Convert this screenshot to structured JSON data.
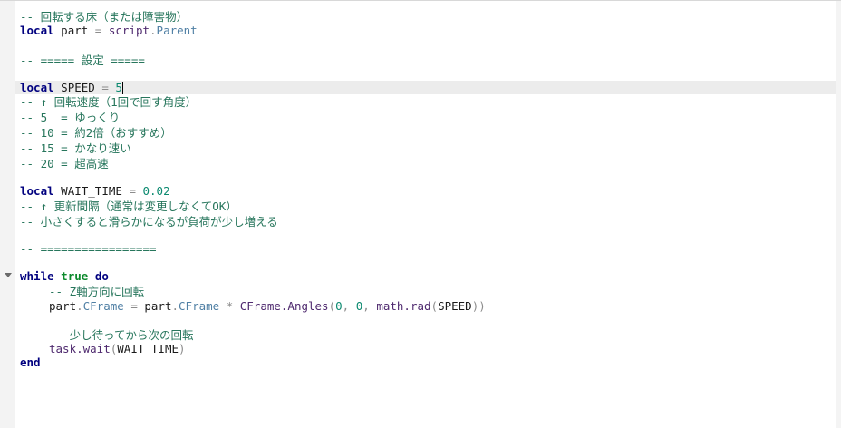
{
  "code": {
    "lines": [
      {
        "parts": [
          {
            "t": "-- 回転する床（または障害物）",
            "c": "cm"
          }
        ]
      },
      {
        "parts": [
          {
            "t": "local",
            "c": "kw"
          },
          {
            "t": " part ",
            "c": "id"
          },
          {
            "t": "=",
            "c": "op"
          },
          {
            "t": " ",
            "c": "id"
          },
          {
            "t": "script",
            "c": "fn"
          },
          {
            "t": ".",
            "c": "op"
          },
          {
            "t": "Parent",
            "c": "pr"
          }
        ]
      },
      {
        "parts": []
      },
      {
        "parts": [
          {
            "t": "-- ===== 設定 =====",
            "c": "cm"
          }
        ]
      },
      {
        "parts": []
      },
      {
        "parts": [
          {
            "t": "local",
            "c": "kw"
          },
          {
            "t": " SPEED ",
            "c": "id"
          },
          {
            "t": "=",
            "c": "op"
          },
          {
            "t": " ",
            "c": "id"
          },
          {
            "t": "5",
            "c": "nm"
          }
        ],
        "caret": true
      },
      {
        "parts": [
          {
            "t": "-- ↑ 回転速度（1回で回す角度）",
            "c": "cm"
          }
        ]
      },
      {
        "parts": [
          {
            "t": "-- 5  = ゆっくり",
            "c": "cm"
          }
        ]
      },
      {
        "parts": [
          {
            "t": "-- 10 = 約2倍（おすすめ）",
            "c": "cm"
          }
        ]
      },
      {
        "parts": [
          {
            "t": "-- 15 = かなり速い",
            "c": "cm"
          }
        ]
      },
      {
        "parts": [
          {
            "t": "-- 20 = 超高速",
            "c": "cm"
          }
        ]
      },
      {
        "parts": []
      },
      {
        "parts": [
          {
            "t": "local",
            "c": "kw"
          },
          {
            "t": " WAIT_TIME ",
            "c": "id"
          },
          {
            "t": "=",
            "c": "op"
          },
          {
            "t": " ",
            "c": "id"
          },
          {
            "t": "0.02",
            "c": "nm"
          }
        ]
      },
      {
        "parts": [
          {
            "t": "-- ↑ 更新間隔（通常は変更しなくてOK）",
            "c": "cm"
          }
        ]
      },
      {
        "parts": [
          {
            "t": "-- 小さくすると滑らかになるが負荷が少し増える",
            "c": "cm"
          }
        ]
      },
      {
        "parts": []
      },
      {
        "parts": [
          {
            "t": "-- =================",
            "c": "cm"
          }
        ]
      },
      {
        "parts": []
      },
      {
        "parts": [
          {
            "t": "while",
            "c": "kw"
          },
          {
            "t": " ",
            "c": "id"
          },
          {
            "t": "true",
            "c": "bl"
          },
          {
            "t": " ",
            "c": "id"
          },
          {
            "t": "do",
            "c": "kw"
          }
        ],
        "fold": true
      },
      {
        "indent": 1,
        "parts": [
          {
            "t": "-- Z軸方向に回転",
            "c": "cm"
          }
        ]
      },
      {
        "indent": 1,
        "parts": [
          {
            "t": "part",
            "c": "id"
          },
          {
            "t": ".",
            "c": "op"
          },
          {
            "t": "CFrame",
            "c": "pr"
          },
          {
            "t": " = ",
            "c": "op"
          },
          {
            "t": "part",
            "c": "id"
          },
          {
            "t": ".",
            "c": "op"
          },
          {
            "t": "CFrame",
            "c": "pr"
          },
          {
            "t": " * ",
            "c": "op"
          },
          {
            "t": "CFrame.Angles",
            "c": "fn"
          },
          {
            "t": "(",
            "c": "op"
          },
          {
            "t": "0",
            "c": "nm"
          },
          {
            "t": ", ",
            "c": "op"
          },
          {
            "t": "0",
            "c": "nm"
          },
          {
            "t": ", ",
            "c": "op"
          },
          {
            "t": "math.rad",
            "c": "fn"
          },
          {
            "t": "(",
            "c": "op"
          },
          {
            "t": "SPEED",
            "c": "id"
          },
          {
            "t": "))",
            "c": "op"
          }
        ]
      },
      {
        "parts": []
      },
      {
        "indent": 1,
        "parts": [
          {
            "t": "-- 少し待ってから次の回転",
            "c": "cm"
          }
        ]
      },
      {
        "indent": 1,
        "parts": [
          {
            "t": "task.wait",
            "c": "fn"
          },
          {
            "t": "(",
            "c": "op"
          },
          {
            "t": "WAIT_TIME",
            "c": "id"
          },
          {
            "t": ")",
            "c": "op"
          }
        ]
      },
      {
        "parts": [
          {
            "t": "end",
            "c": "kw"
          }
        ]
      }
    ]
  }
}
